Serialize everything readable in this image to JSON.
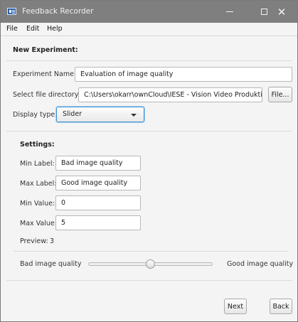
{
  "window": {
    "title": "Feedback Recorder"
  },
  "menu": {
    "items": [
      "File",
      "Edit",
      "Help"
    ]
  },
  "experiment": {
    "heading": "New Experiment:",
    "name_label": "Experiment Name:",
    "name_value": "Evaluation of image quality",
    "directory_label": "Select file directory:",
    "directory_value": "C:\\Users\\okarr\\ownCloud\\IESE - Vision Video Produktion\\F",
    "file_button": "File...",
    "display_type_label": "Display type:",
    "display_type_value": "Slider"
  },
  "settings": {
    "heading": "Settings:",
    "min_label_label": "Min Label:",
    "min_label_value": "Bad image quality",
    "max_label_label": "Max Label:",
    "max_label_value": "Good image quality",
    "min_value_label": "Min Value:",
    "min_value_value": "0",
    "max_value_label": "Max Value:",
    "max_value_value": "5",
    "preview_label": "Preview:",
    "preview_value": "3"
  },
  "preview_slider": {
    "min_text": "Bad image quality",
    "max_text": "Good image quality",
    "min": 0,
    "max": 5,
    "value": 2.5
  },
  "footer": {
    "next_button": "Next",
    "back_button": "Back"
  },
  "colors": {
    "titlebar": "#7f7f7f",
    "focus": "#3c92d4",
    "window_bg": "#f4f4f4"
  },
  "icons": [
    "app-icon",
    "minimize-icon",
    "maximize-icon",
    "close-icon",
    "chevron-down-icon"
  ]
}
